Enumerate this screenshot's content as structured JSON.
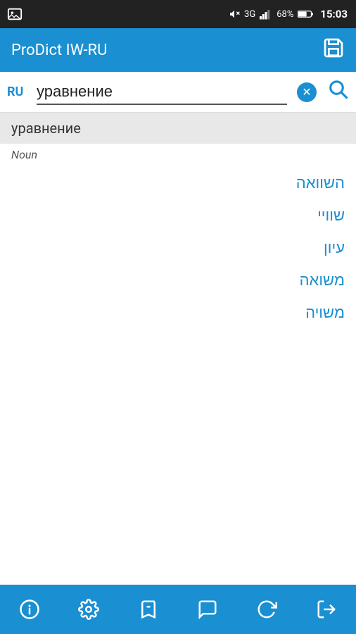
{
  "statusBar": {
    "time": "15:03",
    "battery": "68%",
    "network": "3G"
  },
  "appBar": {
    "title": "ProDict IW-RU",
    "saveIconLabel": "save"
  },
  "searchBar": {
    "lang": "RU",
    "query": "уравнение",
    "clearLabel": "×",
    "searchLabel": "🔍"
  },
  "result": {
    "word": "уравнение",
    "partOfSpeech": "Noun",
    "translations": [
      "השוואה",
      "שוויי",
      "עיון",
      "משואה",
      "משויה"
    ]
  },
  "bottomNav": {
    "items": [
      {
        "name": "info",
        "label": "info"
      },
      {
        "name": "settings",
        "label": "settings"
      },
      {
        "name": "bookmarks",
        "label": "bookmarks"
      },
      {
        "name": "chat",
        "label": "chat"
      },
      {
        "name": "refresh",
        "label": "refresh"
      },
      {
        "name": "exit",
        "label": "exit"
      }
    ]
  }
}
